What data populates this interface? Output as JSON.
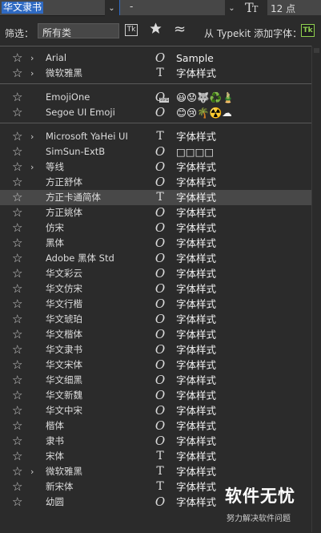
{
  "toolbar": {
    "font_family": "华文隶书",
    "font_style": "-",
    "font_size": "12 点",
    "dropdown_glyph": "⌄"
  },
  "filter": {
    "label": "筛选：",
    "class_value": "所有类",
    "tk_label": "Tk",
    "typekit_label": "从 Typekit 添加字体：",
    "typekit_button": "Tk"
  },
  "icons": {
    "star": "☆",
    "chevron": "›",
    "otf": "O",
    "ttf": "T",
    "svg_tag": "SVG"
  },
  "groups": [
    {
      "fonts": [
        {
          "name": "Arial",
          "type": "otf",
          "expand": true,
          "sample": "Sample"
        },
        {
          "name": "微软雅黑",
          "type": "ttf",
          "expand": true,
          "sample": "字体样式"
        }
      ]
    },
    {
      "fonts": [
        {
          "name": "EmojiOne",
          "type": "svg",
          "expand": false,
          "sample": "😃😟🐺♻️🎍"
        },
        {
          "name": "Segoe UI Emoji",
          "type": "otf",
          "expand": false,
          "sample": "😊😢🌴☢️☁"
        }
      ]
    },
    {
      "fonts": [
        {
          "name": "Microsoft YaHei UI",
          "type": "ttf",
          "expand": true,
          "sample": "字体样式"
        },
        {
          "name": "SimSun-ExtB",
          "type": "otf",
          "expand": false,
          "sample": "□□□□"
        },
        {
          "name": "等线",
          "type": "otf",
          "expand": true,
          "sample": "字体样式"
        },
        {
          "name": "方正舒体",
          "type": "otf",
          "expand": false,
          "sample": "字体样式"
        },
        {
          "name": "方正卡通简体",
          "type": "ttf",
          "expand": false,
          "sample": "字体样式",
          "highlight": true
        },
        {
          "name": "方正姚体",
          "type": "otf",
          "expand": false,
          "sample": "字体样式"
        },
        {
          "name": "仿宋",
          "type": "otf",
          "expand": false,
          "sample": "字体样式"
        },
        {
          "name": "黑体",
          "type": "otf",
          "expand": false,
          "sample": "字体样式"
        },
        {
          "name": "Adobe 黑体 Std",
          "type": "otf",
          "expand": false,
          "sample": "字体样式"
        },
        {
          "name": "华文彩云",
          "type": "otf",
          "expand": false,
          "sample": "字体样式"
        },
        {
          "name": "华文仿宋",
          "type": "otf",
          "expand": false,
          "sample": "字体样式"
        },
        {
          "name": "华文行楷",
          "type": "otf",
          "expand": false,
          "sample": "字体样式"
        },
        {
          "name": "华文琥珀",
          "type": "otf",
          "expand": false,
          "sample": "字体样式"
        },
        {
          "name": "华文楷体",
          "type": "otf",
          "expand": false,
          "sample": "字体样式"
        },
        {
          "name": "华文隶书",
          "type": "otf",
          "expand": false,
          "sample": "字体样式"
        },
        {
          "name": "华文宋体",
          "type": "otf",
          "expand": false,
          "sample": "字体样式"
        },
        {
          "name": "华文细黑",
          "type": "otf",
          "expand": false,
          "sample": "字体样式"
        },
        {
          "name": "华文新魏",
          "type": "otf",
          "expand": false,
          "sample": "字体样式"
        },
        {
          "name": "华文中宋",
          "type": "otf",
          "expand": false,
          "sample": "字体样式"
        },
        {
          "name": "楷体",
          "type": "otf",
          "expand": false,
          "sample": "字体样式"
        },
        {
          "name": "隶书",
          "type": "otf",
          "expand": false,
          "sample": "字体样式"
        },
        {
          "name": "宋体",
          "type": "ttf",
          "expand": false,
          "sample": "字体样式"
        },
        {
          "name": "微软雅黑",
          "type": "ttf",
          "expand": true,
          "sample": "字体样式"
        },
        {
          "name": "新宋体",
          "type": "ttf",
          "expand": false,
          "sample": "字体样式"
        },
        {
          "name": "幼圆",
          "type": "otf",
          "expand": false,
          "sample": "字体样式"
        }
      ]
    }
  ],
  "watermark": {
    "title": "软件无忧",
    "subtitle": "努力解决软件问题"
  }
}
